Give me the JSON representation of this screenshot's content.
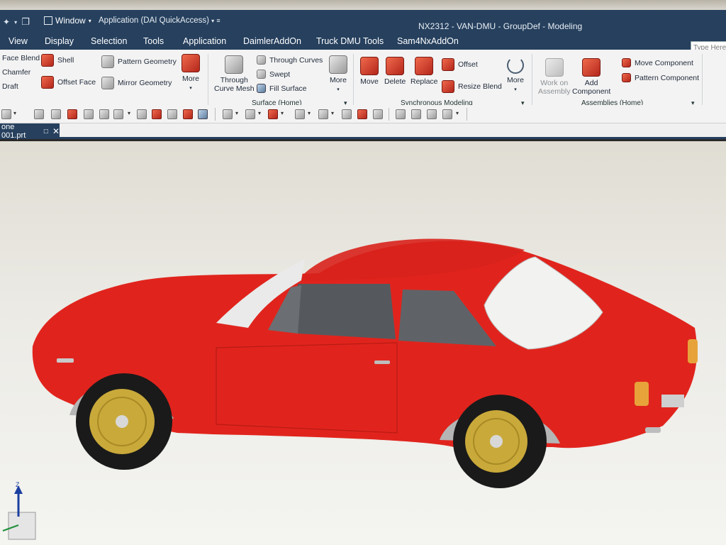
{
  "title_bar": {
    "window_menu": "Window",
    "application_dropdown": "Application (DAI QuickAccess)",
    "title": "NX2312 - VAN-DMU - GroupDef - Modeling"
  },
  "tabs": [
    "View",
    "Display",
    "Selection",
    "Tools",
    "Application",
    "DaimlerAddOn",
    "Truck DMU Tools",
    "Sam4NxAddOn"
  ],
  "search": {
    "placeholder": "Type Here"
  },
  "ribbon": {
    "feature": {
      "face_blend": "Face Blend",
      "chamfer": "Chamfer",
      "draft": "Draft",
      "shell": "Shell",
      "offset_face": "Offset Face",
      "pattern_geometry": "Pattern Geometry",
      "mirror_geometry": "Mirror Geometry",
      "more": "More"
    },
    "surface": {
      "through_curve_mesh_1": "Through",
      "through_curve_mesh_2": "Curve Mesh",
      "through_curves": "Through Curves",
      "swept": "Swept",
      "fill_surface": "Fill Surface",
      "more": "More",
      "group_label": "Surface (Home)"
    },
    "synchronous": {
      "move": "Move",
      "delete": "Delete",
      "replace": "Replace",
      "offset": "Offset",
      "resize_blend": "Resize Blend",
      "more": "More",
      "group_label": "Synchronous Modeling"
    },
    "assemblies": {
      "work_on_assembly_1": "Work on",
      "work_on_assembly_2": "Assembly",
      "add_component_1": "Add",
      "add_component_2": "Component",
      "move_component": "Move Component",
      "pattern_component": "Pattern Component",
      "group_label": "Assemblies (Home)"
    }
  },
  "document_tab": {
    "label": "one 001.prt"
  },
  "viewport": {
    "car_body_color": "#e0241d",
    "wheel_color": "#c9a93a",
    "axis_label": "Z"
  }
}
